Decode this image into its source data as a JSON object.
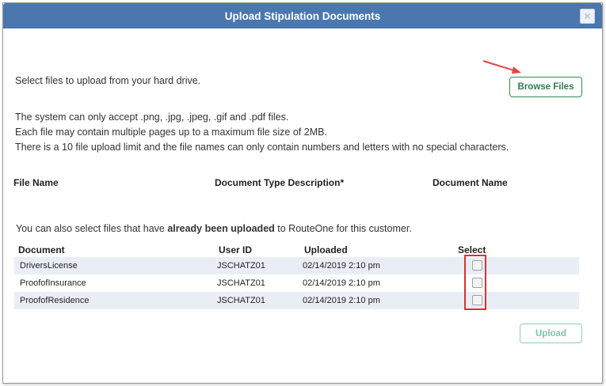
{
  "dialog": {
    "title": "Upload Stipulation Documents",
    "close_label": "×"
  },
  "intro": {
    "select_text": "Select files to upload from your hard drive.",
    "browse_label": "Browse Files",
    "rules": [
      "The system can only accept .png, .jpg, .jpeg, .gif and .pdf files.",
      "Each file may contain multiple pages up to a maximum file size of 2MB.",
      "There is a 10 file upload limit and the file names can only contain numbers and letters with no special characters."
    ]
  },
  "upload_columns": {
    "file_name": "File Name",
    "doc_type": "Document Type Description*",
    "doc_name": "Document Name"
  },
  "uploaded": {
    "prefix": "You can also select files that have ",
    "bold": "already been uploaded",
    "suffix": " to RouteOne for this customer.",
    "headers": {
      "document": "Document",
      "user_id": "User ID",
      "uploaded": "Uploaded",
      "select": "Select"
    },
    "rows": [
      {
        "document": "DriversLicense",
        "user_id": "JSCHATZ01",
        "uploaded": "02/14/2019 2:10 pm",
        "selected": false
      },
      {
        "document": "ProofofInsurance",
        "user_id": "JSCHATZ01",
        "uploaded": "02/14/2019 2:10 pm",
        "selected": false
      },
      {
        "document": "ProofofResidence",
        "user_id": "JSCHATZ01",
        "uploaded": "02/14/2019 2:10 pm",
        "selected": false
      }
    ]
  },
  "actions": {
    "upload_label": "Upload"
  },
  "colors": {
    "title_bar": "#4a77ad",
    "browse_border": "#2e8b57",
    "highlight_red": "#d9322f",
    "row_alt": "#e9eef6"
  }
}
